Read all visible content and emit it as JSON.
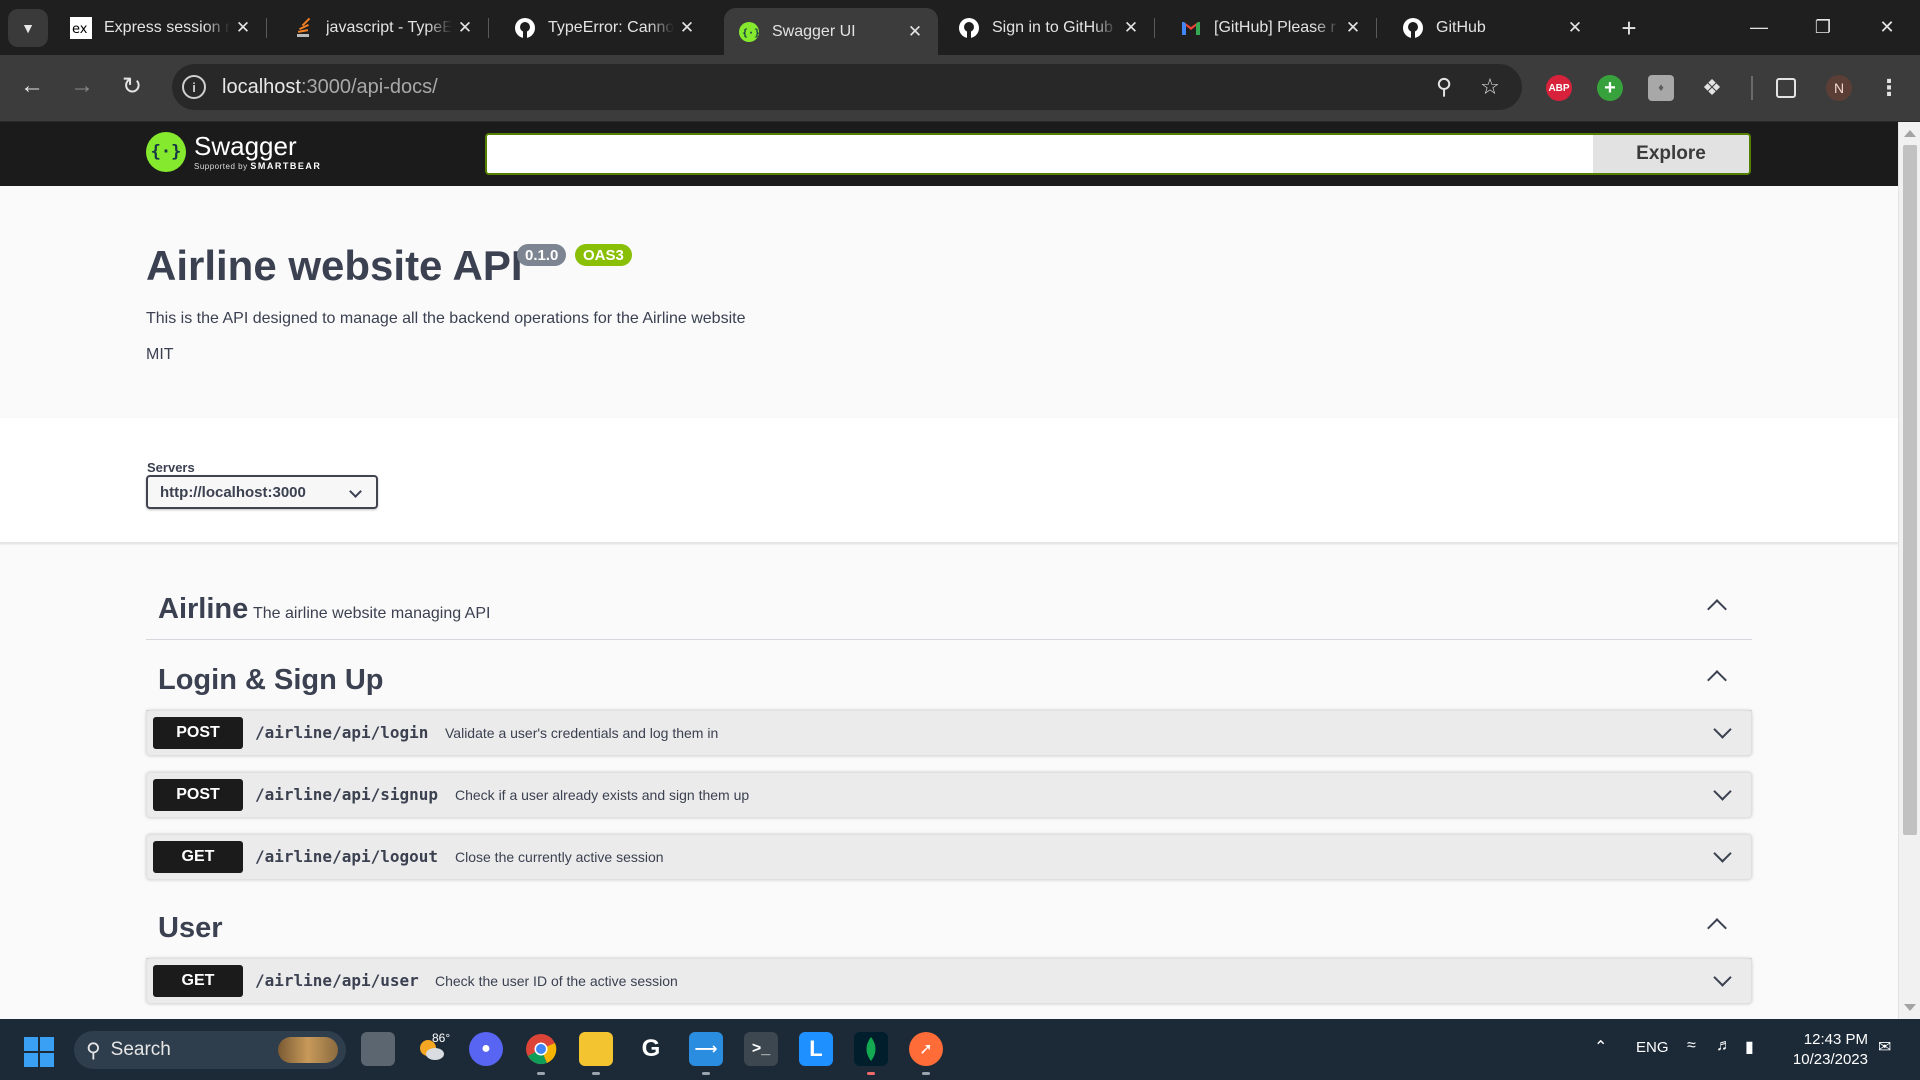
{
  "browser": {
    "tabs": [
      {
        "title": "Express session m",
        "favicon": "express-icon",
        "active": false
      },
      {
        "title": "javascript - TypeE",
        "favicon": "stackoverflow-icon",
        "active": false
      },
      {
        "title": "TypeError: Canno",
        "favicon": "github-icon",
        "active": false
      },
      {
        "title": "Swagger UI",
        "favicon": "swagger-icon",
        "active": true
      },
      {
        "title": "Sign in to GitHub",
        "favicon": "github-icon",
        "active": false
      },
      {
        "title": "[GitHub] Please r",
        "favicon": "gmail-icon",
        "active": false
      },
      {
        "title": "GitHub",
        "favicon": "github-icon",
        "active": false
      }
    ],
    "url_host": "localhost",
    "url_rest": ":3000/api-docs/",
    "extensions": {
      "abp": "ABP",
      "avatar": "N"
    }
  },
  "swagger": {
    "brand": "Swagger",
    "supported_by": "Supported by",
    "smartbear": "SMARTBEAR",
    "search_value": "",
    "explore_label": "Explore",
    "title": "Airline website API",
    "version": "0.1.0",
    "oas": "OAS3",
    "description": "This is the API designed to manage all the backend operations for the Airline website",
    "license": "MIT",
    "servers_label": "Servers",
    "server_selected": "http://localhost:3000",
    "tags": [
      {
        "name": "Airline",
        "description": "The airline website managing API"
      },
      {
        "name": "Login & Sign Up",
        "description": ""
      },
      {
        "name": "User",
        "description": ""
      }
    ],
    "operations": [
      {
        "method": "POST",
        "path": "/airline/api/login",
        "summary": "Validate a user's credentials and log them in"
      },
      {
        "method": "POST",
        "path": "/airline/api/signup",
        "summary": "Check if a user already exists and sign them up"
      },
      {
        "method": "GET",
        "path": "/airline/api/logout",
        "summary": "Close the currently active session"
      },
      {
        "method": "GET",
        "path": "/airline/api/user",
        "summary": "Check the user ID of the active session"
      }
    ]
  },
  "taskbar": {
    "search_label": "Search",
    "weather_temp": "86°",
    "language": "ENG",
    "time": "12:43 PM",
    "date": "10/23/2023"
  },
  "colors": {
    "method_bg": "#1b1b1b",
    "version_badge": "#7d8492",
    "oas_badge": "#89bf04",
    "swagger_green": "#85ea2d"
  }
}
